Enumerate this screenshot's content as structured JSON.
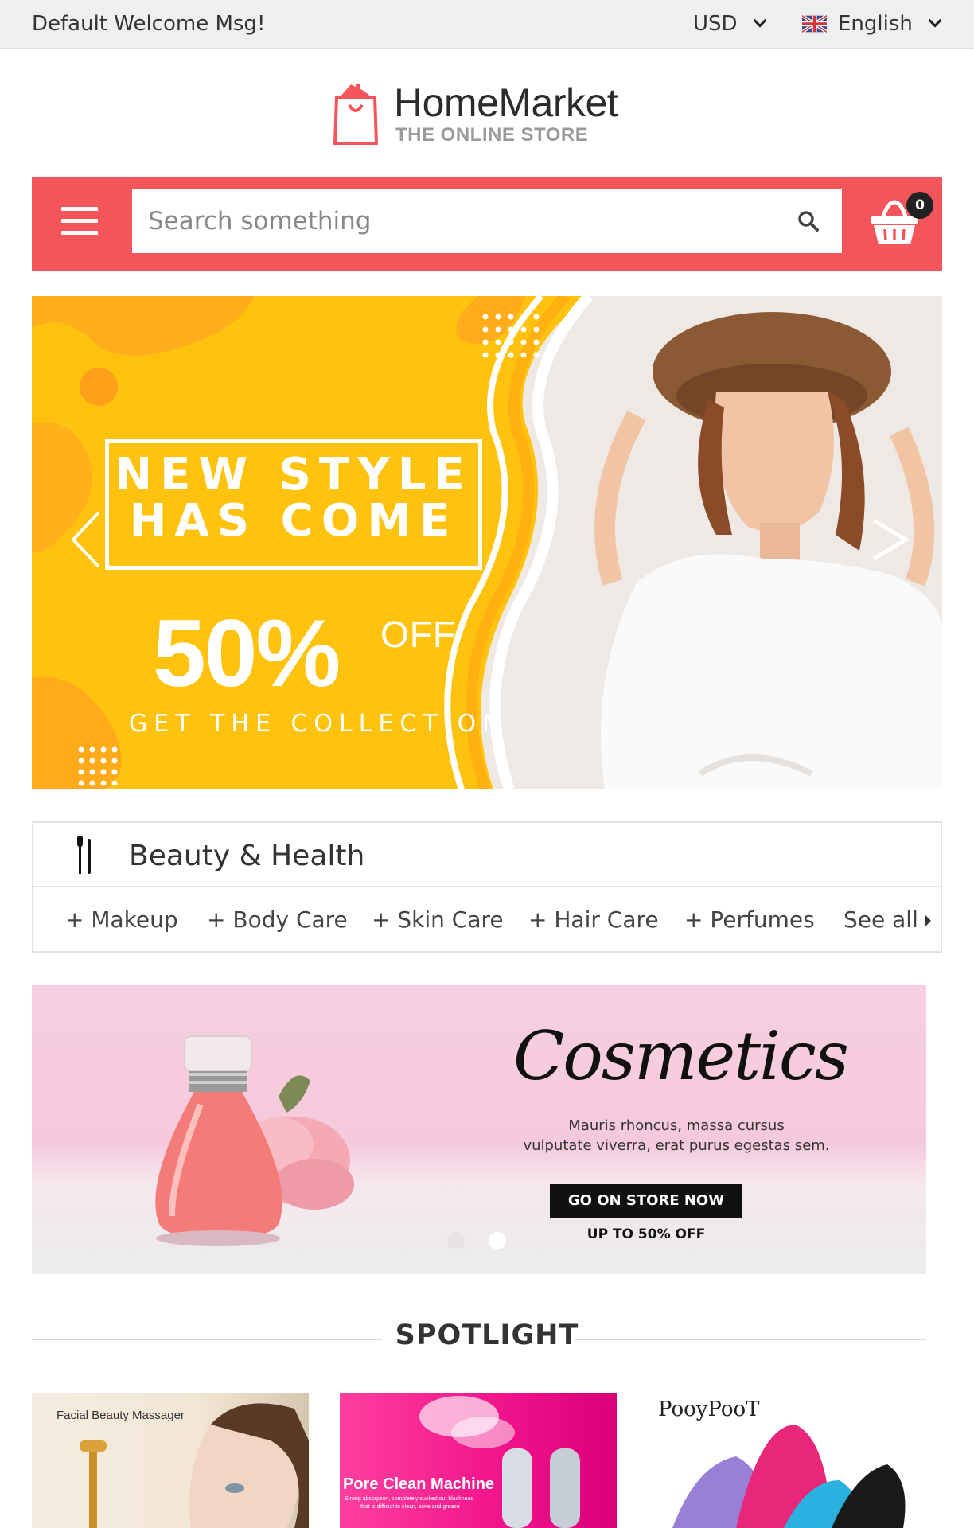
{
  "topbar": {
    "welcome": "Default Welcome Msg!",
    "currency": "USD",
    "language": "English",
    "flag_icon": "uk-flag-icon"
  },
  "logo": {
    "brand": "HomeMarket",
    "tagline": "THE ONLINE STORE"
  },
  "search": {
    "placeholder": "Search something",
    "cart_count": "0",
    "accent_color": "#f4555b"
  },
  "hero": {
    "headline_line1": "NEW STYLE",
    "headline_line2": "HAS COME",
    "discount": "50%",
    "discount_suffix": "OFF",
    "subline": "GET THE COLLECTION",
    "background_color": "#ffc20e"
  },
  "category": {
    "title": "Beauty & Health",
    "links": [
      "+ Makeup",
      "+ Body Care",
      "+ Skin Care",
      "+ Hair Care",
      "+ Perfumes"
    ],
    "see_all": "See all"
  },
  "promo": {
    "title": "Cosmetics",
    "description_line1": "Mauris rhoncus, massa cursus",
    "description_line2": "vulputate viverra, erat purus egestas sem.",
    "cta": "GO ON STORE NOW",
    "offer": "UP TO 50% OFF"
  },
  "spotlight": {
    "title": "SPOTLIGHT",
    "cards": [
      {
        "caption": "Facial Beauty Massager"
      },
      {
        "caption": "Pore Clean Machine",
        "sub1": "Strong absorption, completely sucked out blackhead",
        "sub2": "that is difficult to clean, acne and grease"
      },
      {
        "caption": "PooyPooT"
      }
    ]
  }
}
